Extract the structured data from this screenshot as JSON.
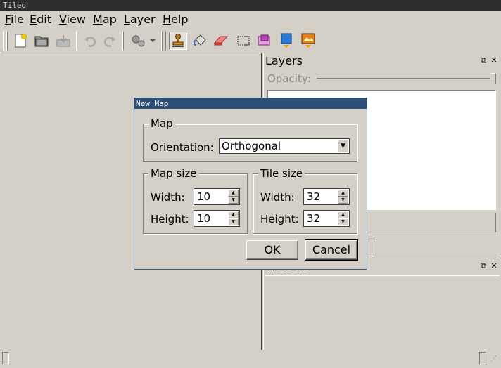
{
  "window": {
    "title": "Tiled"
  },
  "menubar": {
    "items": [
      {
        "label": "File",
        "accel": "F",
        "rest": "ile"
      },
      {
        "label": "Edit",
        "accel": "E",
        "rest": "dit"
      },
      {
        "label": "View",
        "accel": "V",
        "rest": "iew"
      },
      {
        "label": "Map",
        "accel": "M",
        "rest": "ap"
      },
      {
        "label": "Layer",
        "accel": "L",
        "rest": "ayer"
      },
      {
        "label": "Help",
        "accel": "H",
        "rest": "elp"
      }
    ]
  },
  "toolbar": {
    "icons": [
      "new-map-icon",
      "open-folder-icon",
      "save-icon",
      "undo-icon",
      "redo-icon",
      "commands-icon",
      "stamp-brush-icon",
      "bucket-fill-icon",
      "eraser-icon",
      "rectangle-select-icon",
      "tile-select-icon",
      "object-select-icon",
      "image-layer-icon"
    ]
  },
  "layers_panel": {
    "title": "Layers",
    "opacity_label": "Opacity:",
    "opacity_value": 1.0
  },
  "tilesets_panel": {
    "title": "Tilesets"
  },
  "dialog": {
    "title": "New Map",
    "map_group": "Map",
    "orientation_label": "Orientation:",
    "orientation_value": "Orthogonal",
    "map_size_group": "Map size",
    "tile_size_group": "Tile size",
    "width_label": "Width:",
    "height_label": "Height:",
    "map_width": "10",
    "map_height": "10",
    "tile_width": "32",
    "tile_height": "32",
    "ok_label": "OK",
    "cancel_label": "Cancel"
  }
}
